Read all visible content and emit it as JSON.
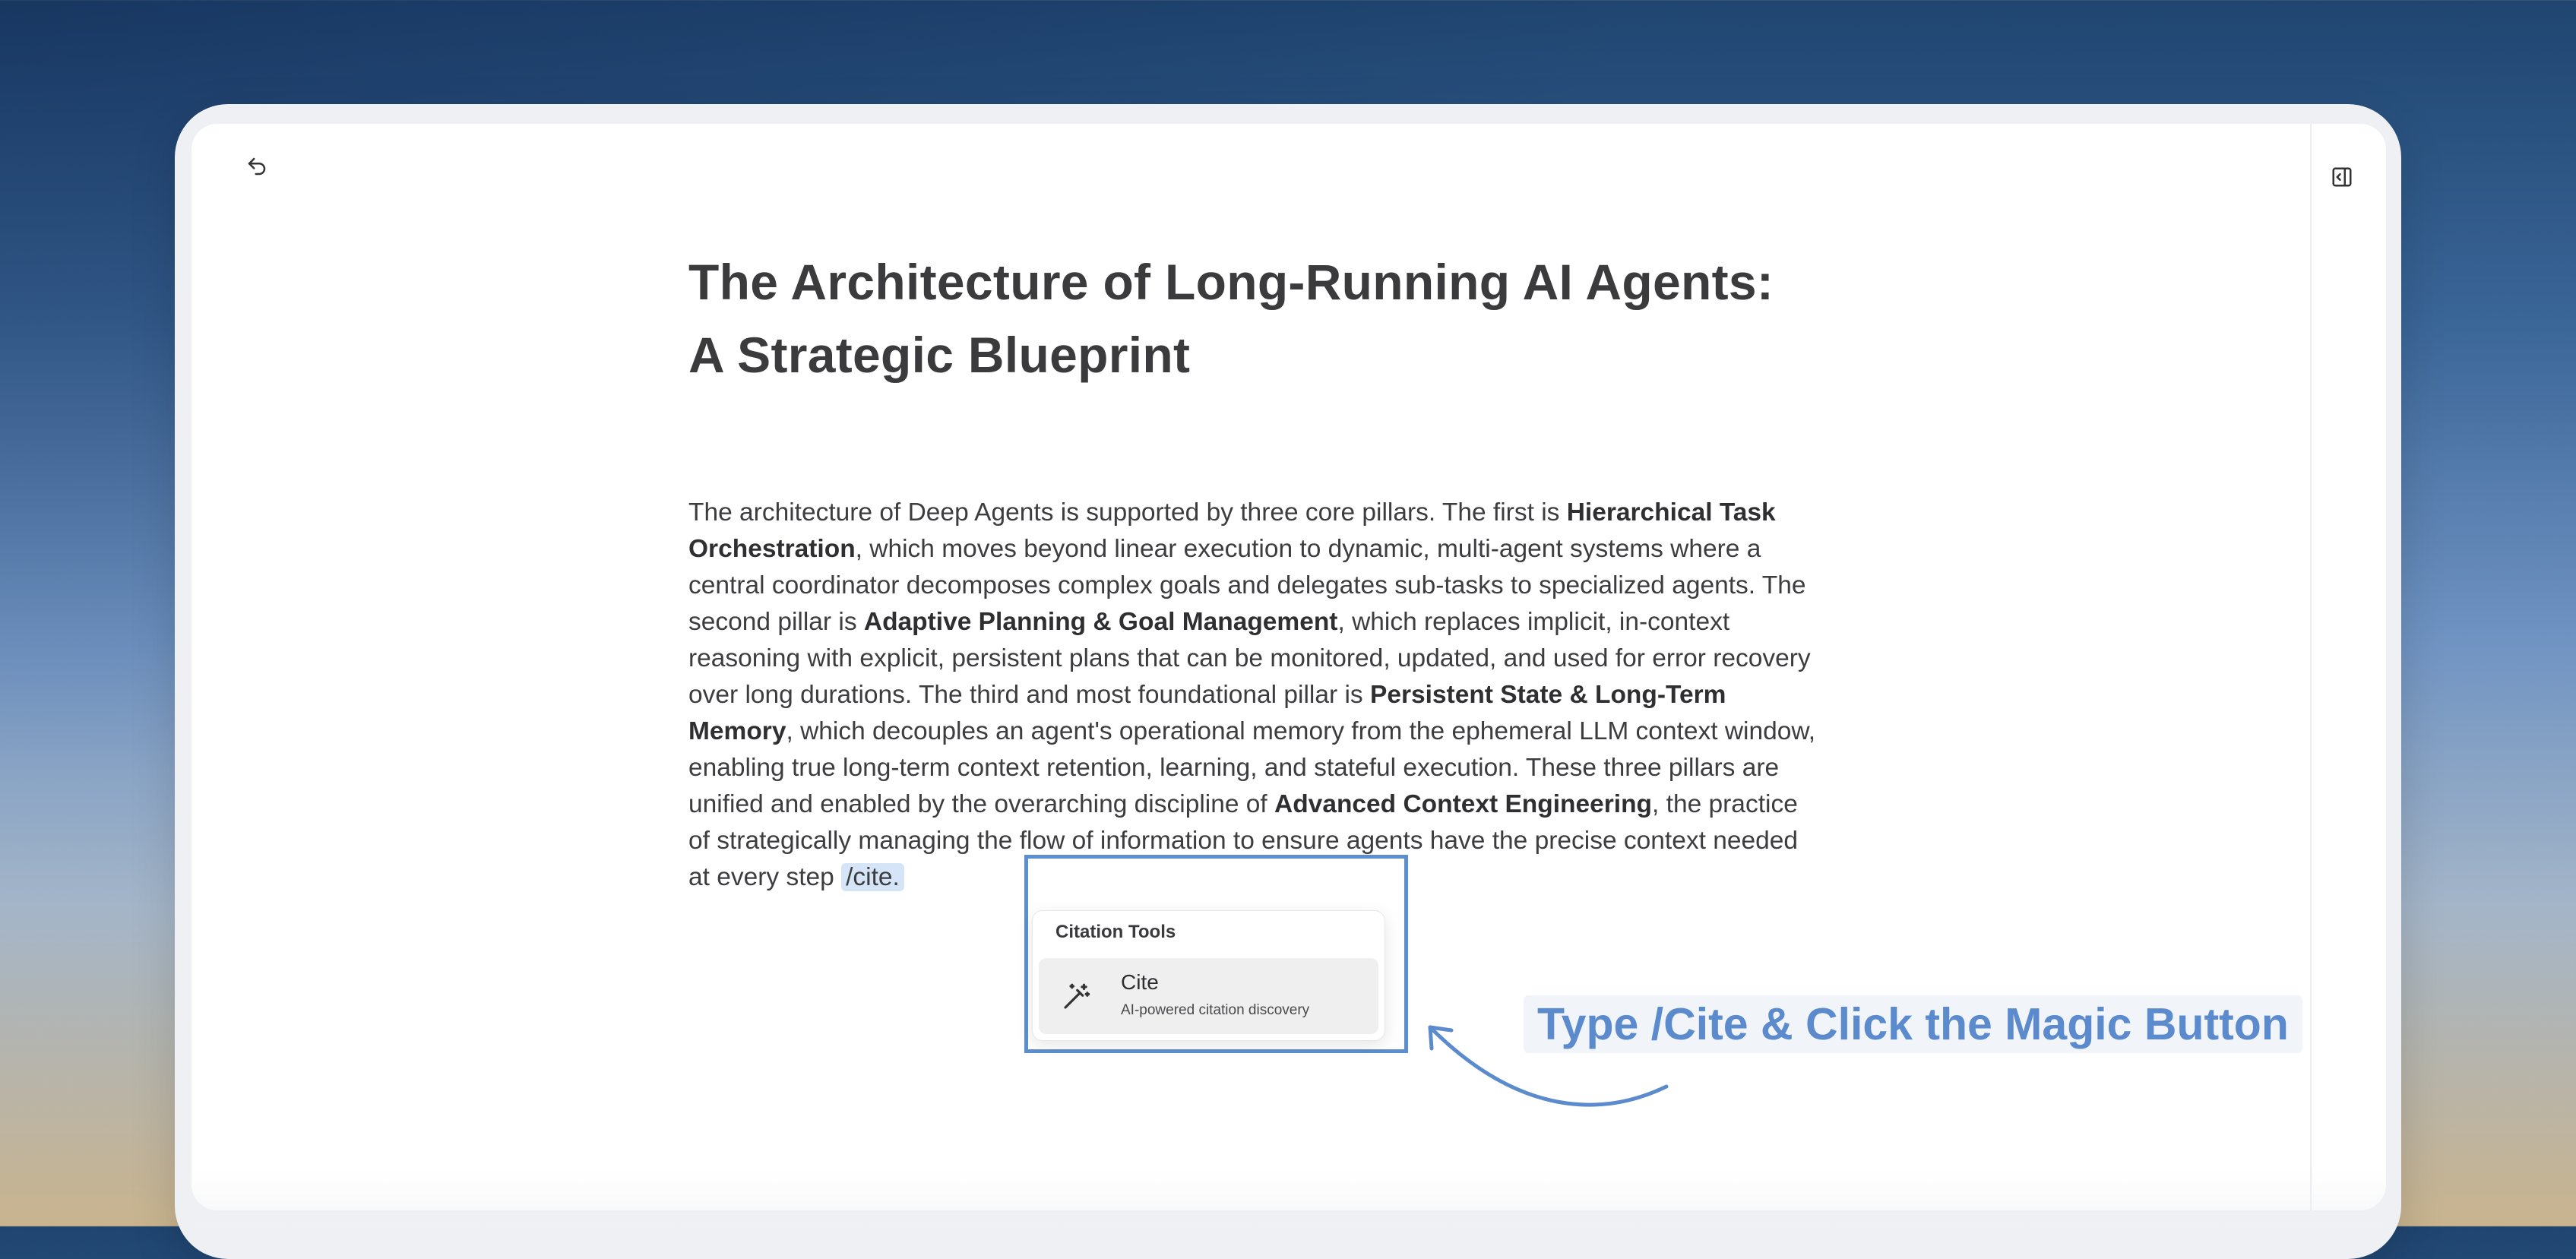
{
  "toolbar": {
    "undo_icon": "undo-icon",
    "sidebar_toggle_icon": "sidebar-toggle-icon"
  },
  "document": {
    "title_line1": "The Architecture of Long-Running AI Agents:",
    "title_line2": "A Strategic Blueprint",
    "body": {
      "t1": "The architecture of Deep Agents is supported by three core pillars. The first is ",
      "b1": "Hierarchical Task Orchestration",
      "t2": ", which moves beyond linear execution to dynamic, multi-agent systems where a central coordinator decomposes complex goals and delegates sub-tasks to specialized agents. The second pillar is ",
      "b2": "Adaptive Planning & Goal Management",
      "t3": ", which replaces implicit, in-context reasoning with explicit, persistent plans that can be monitored, updated, and used for error recovery over long durations. The third and most foundational pillar is ",
      "b3": "Persistent State & Long-Term Memory",
      "t4": ", which decouples an agent's operational memory from the ephemeral LLM context window, enabling true long-term context retention, learning, and stateful execution. These three pillars are unified and enabled by the overarching discipline of ",
      "b4": "Advanced Context Engineering",
      "t5": ", the practice of strategically managing the flow of information to ensure agents have the precise context needed at every step",
      "cite_token": "/cite."
    }
  },
  "popover": {
    "title": "Citation Tools",
    "items": [
      {
        "label": "Cite",
        "description": "AI-powered citation discovery",
        "icon": "magic-wand-icon"
      }
    ]
  },
  "annotation": {
    "callout": "Type /Cite & Click the Magic Button"
  },
  "colors": {
    "accent": "#5b8bcd",
    "highlight": "#d6e4f7",
    "text": "#3d3d40"
  }
}
